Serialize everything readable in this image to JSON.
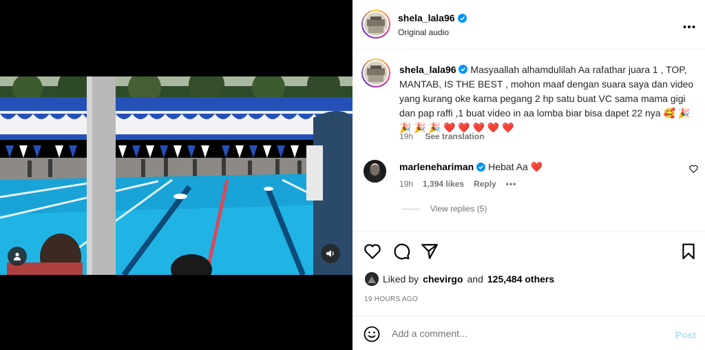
{
  "post": {
    "username": "shela_lala96",
    "audio": "Original audio",
    "more_icon": "more-horizontal-icon",
    "caption": "Masyaallah alhamdulilah Aa rafathar juara 1 , TOP, MANTAB, IS THE BEST , mohon maaf dengan suara saya dan video yang kurang oke karna pegang 2 hp satu buat VC sama mama gigi dan pap raffi ,1 buat video in aa lomba biar bisa dapet 22 nya 🥰 🎉 🎉 🎉 🎉 ❤️ ❤️ ❤️ ❤️ ❤️",
    "caption_age": "19h",
    "see_translation": "See translation"
  },
  "comment": {
    "username": "marlenehariman",
    "text": "Hebat Aa",
    "emoji": "❤️",
    "age": "19h",
    "likes": "1,394 likes",
    "reply": "Reply",
    "more": "•••",
    "view_replies": "View replies (5)"
  },
  "actions": {
    "liked_by_prefix": "Liked by",
    "liked_by_user": "chevirgo",
    "and": "and",
    "others": "125,484 others",
    "timestamp": "19 HOURS AGO"
  },
  "add_comment": {
    "placeholder": "Add a comment...",
    "post_label": "Post"
  },
  "colors": {
    "verified": "#0095f6",
    "post_disabled": "#b2dffc",
    "heart_red": "#ed4956"
  }
}
